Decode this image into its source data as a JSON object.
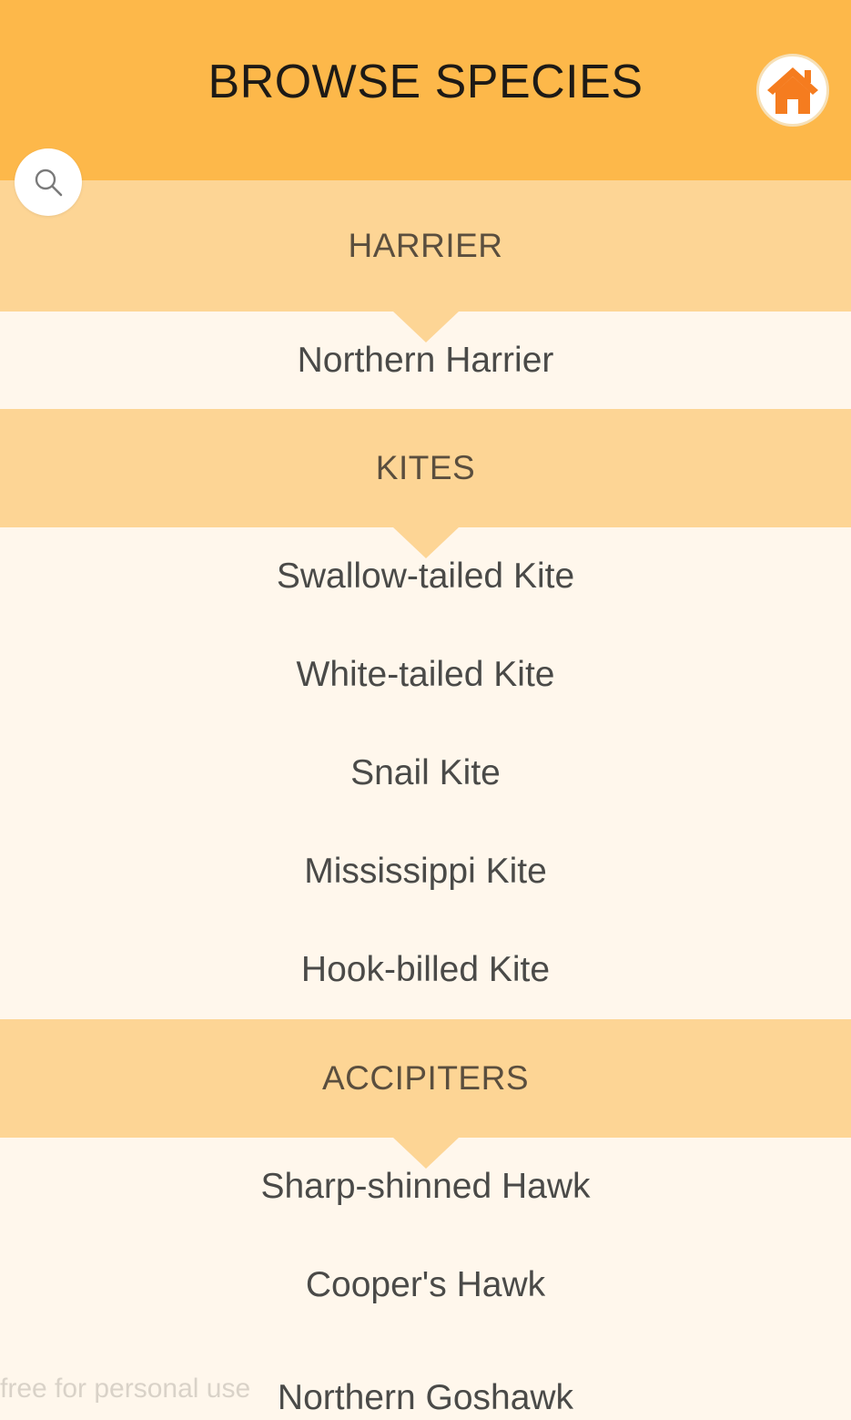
{
  "header": {
    "title": "BROWSE SPECIES",
    "background": "#fdb84a",
    "home_icon": "home-icon",
    "search_icon": "search-icon",
    "accent": "#f57c1f"
  },
  "sections": [
    {
      "label": "HARRIER",
      "items": [
        "Northern Harrier"
      ]
    },
    {
      "label": "KITES",
      "items": [
        "Swallow-tailed Kite",
        "White-tailed Kite",
        "Snail Kite",
        "Mississippi Kite",
        "Hook-billed Kite"
      ]
    },
    {
      "label": "ACCIPITERS",
      "items": [
        "Sharp-shinned Hawk",
        "Cooper's Hawk",
        "Northern Goshawk"
      ]
    }
  ],
  "watermark": "free for personal use"
}
